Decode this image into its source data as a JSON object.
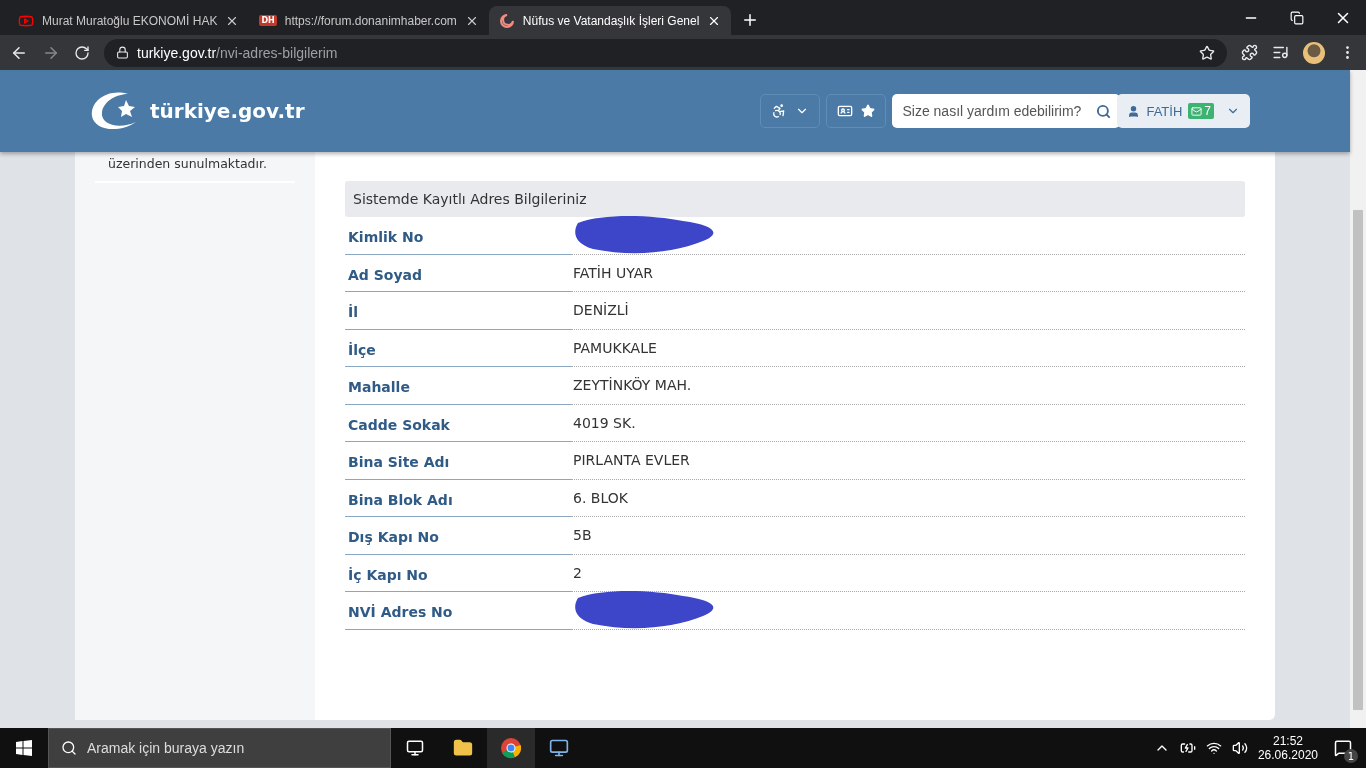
{
  "browser": {
    "tabs": [
      {
        "title": "Murat Muratoğlu EKONOMİ HAK",
        "selected": false
      },
      {
        "title": "https://forum.donanimhaber.com",
        "selected": false
      },
      {
        "title": "Nüfus ve Vatandaşlık İşleri Genel",
        "selected": true
      }
    ],
    "dh_badge": "DH",
    "url_host": "turkiye.gov.tr",
    "url_path": "/nvi-adres-bilgilerim"
  },
  "header": {
    "logo": "türkiye.gov.tr",
    "search": {
      "placeholder": "Size nasıl yardım edebilirim?"
    },
    "user": "FATİH",
    "messages": "7"
  },
  "sidebar": {
    "text": "üzerinden sunulmaktadır."
  },
  "panel": {
    "title": "Sistemde Kayıtlı Adres Bilgileriniz",
    "rows": [
      {
        "label": "Kimlik No",
        "kind": "redacted"
      },
      {
        "label": "Ad Soyad",
        "kind": "text",
        "value": "FATİH UYAR"
      },
      {
        "label": "İl",
        "kind": "text",
        "value": "DENİZLİ"
      },
      {
        "label": "İlçe",
        "kind": "text",
        "value": "PAMUKKALE"
      },
      {
        "label": "Mahalle",
        "kind": "text",
        "value": "ZEYTİNKÖY MAH."
      },
      {
        "label": "Cadde Sokak",
        "kind": "text",
        "value": "4019 SK."
      },
      {
        "label": "Bina Site Adı",
        "kind": "text",
        "value": "PIRLANTA EVLER"
      },
      {
        "label": "Bina Blok Adı",
        "kind": "text",
        "value": "6. BLOK"
      },
      {
        "label": "Dış Kapı No",
        "kind": "text",
        "value": "5B"
      },
      {
        "label": "İç Kapı No",
        "kind": "text",
        "value": "2"
      },
      {
        "label": "NVİ Adres No",
        "kind": "redacted"
      }
    ]
  },
  "taskbar": {
    "search_placeholder": "Aramak için buraya yazın",
    "time": "21:52",
    "date": "26.06.2020",
    "notifications": "1"
  }
}
